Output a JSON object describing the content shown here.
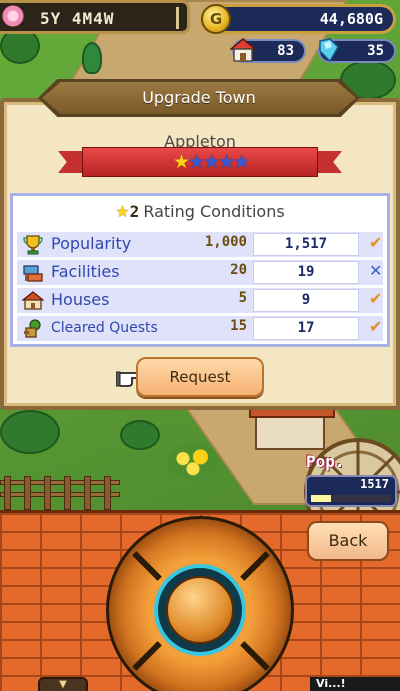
{
  "hud": {
    "date": "5Y 4M4W",
    "money": "44,680G",
    "coin_symbol": "G",
    "houses": "83",
    "gems": "35"
  },
  "dialog": {
    "title": "Upgrade Town",
    "town_name": "Appleton",
    "current_stars": 1,
    "max_stars": 5,
    "conditions_title": "Rating Conditions",
    "conditions_star_level": "2",
    "conditions": [
      {
        "icon": "trophy-icon",
        "label": "Popularity",
        "required": "1,000",
        "current": "1,517",
        "met": true
      },
      {
        "icon": "facility-icon",
        "label": "Facilities",
        "required": "20",
        "current": "19",
        "met": false
      },
      {
        "icon": "house-icon",
        "label": "Houses",
        "required": "5",
        "current": "9",
        "met": true
      },
      {
        "icon": "quest-icon",
        "label": "Cleared Quests",
        "required": "15",
        "current": "17",
        "met": true
      }
    ],
    "request_label": "Request"
  },
  "popularity": {
    "label": "Pop.",
    "value": "1517",
    "fill_fraction": 0.25
  },
  "controls": {
    "back_label": "Back",
    "bottom_label": "Vi...!"
  },
  "colors": {
    "met_mark": "#e0902a",
    "unmet_mark": "#4060c0",
    "label_blue": "#3048b0"
  }
}
